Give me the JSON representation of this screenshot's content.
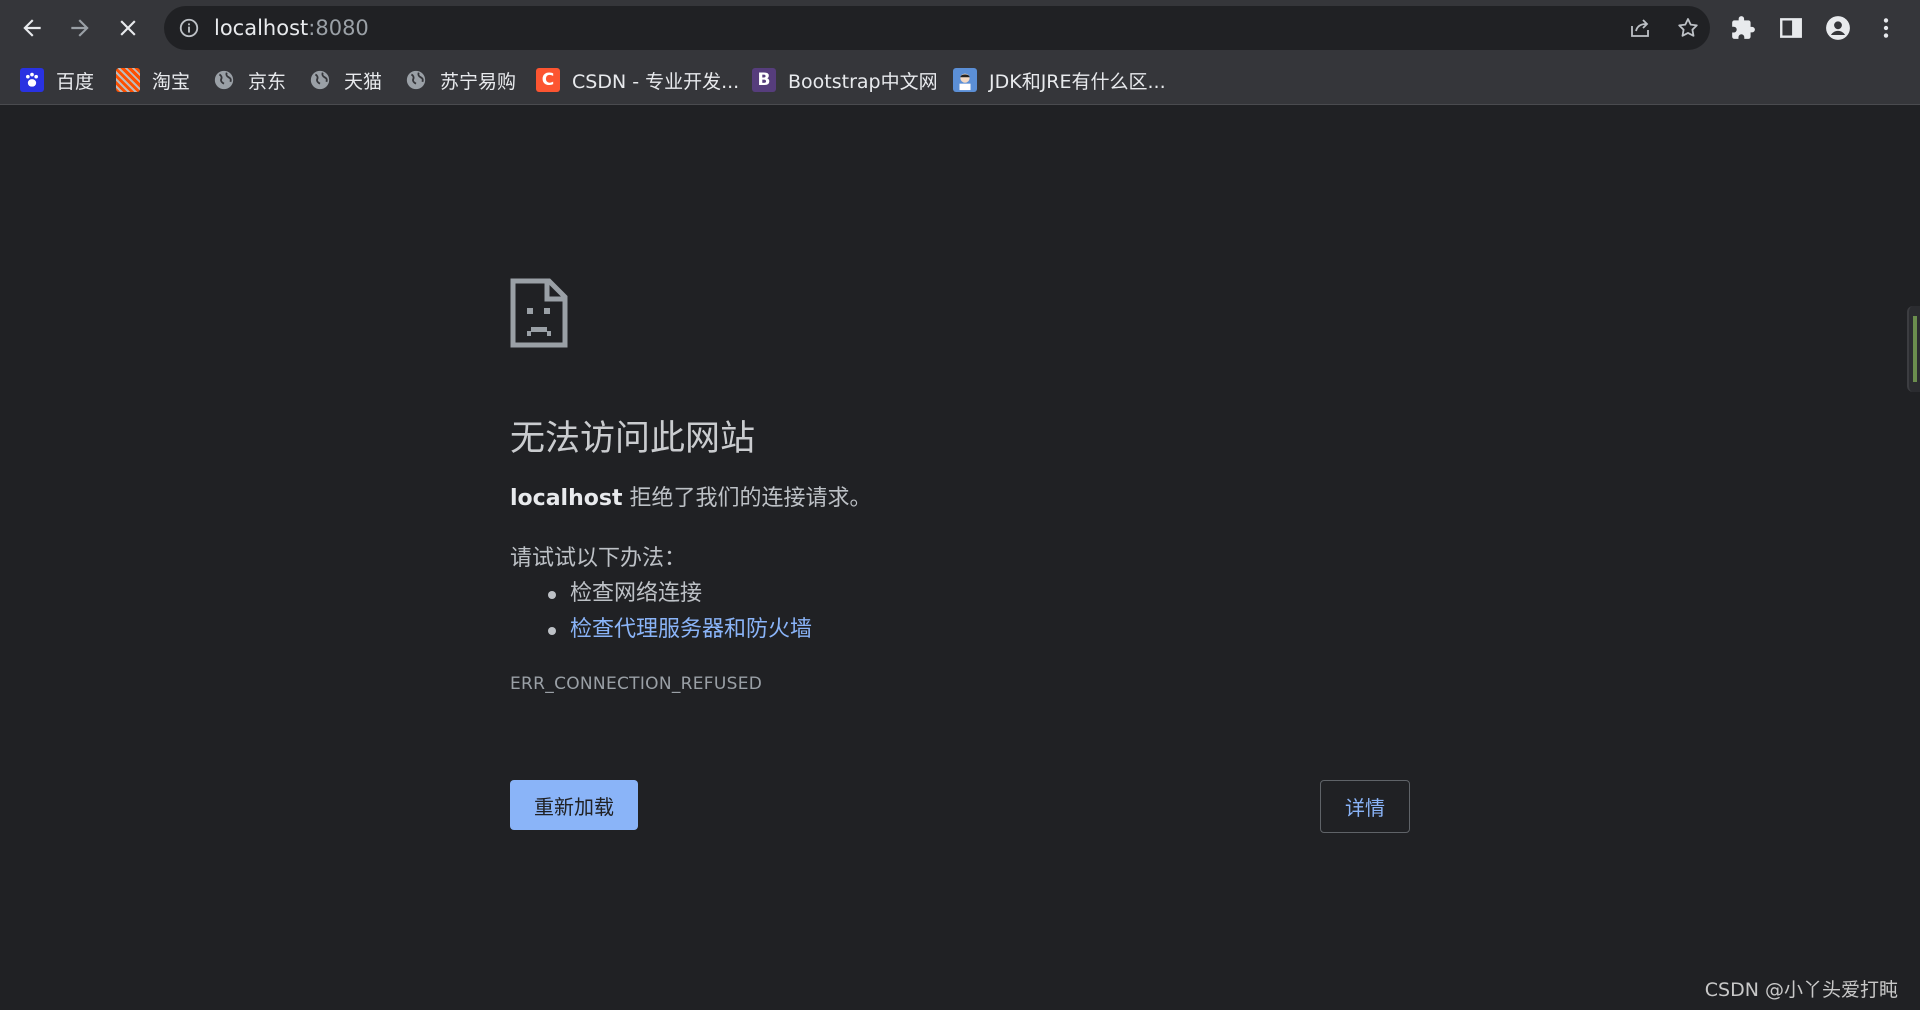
{
  "browser": {
    "url_host": "localhost",
    "url_port": ":8080",
    "buttons": {
      "back_icon": "back-arrow-icon",
      "forward_icon": "forward-arrow-icon",
      "stop_icon": "close-icon"
    }
  },
  "bookmarks": [
    {
      "label": "百度",
      "icon": "baidu-paw-icon",
      "color": "#2932e1"
    },
    {
      "label": "淘宝",
      "icon": "taobao-icon",
      "color": "#ff5000"
    },
    {
      "label": "京东",
      "icon": "globe-icon",
      "color": "#9aa0a6"
    },
    {
      "label": "天猫",
      "icon": "globe-icon",
      "color": "#9aa0a6"
    },
    {
      "label": "苏宁易购",
      "icon": "globe-icon",
      "color": "#9aa0a6"
    },
    {
      "label": "CSDN - 专业开发...",
      "icon": "csdn-icon",
      "glyph": "C",
      "color": "#fc5531"
    },
    {
      "label": "Bootstrap中文网",
      "icon": "bootstrap-icon",
      "glyph": "B",
      "color": "#563d7c"
    },
    {
      "label": "JDK和JRE有什么区...",
      "icon": "avatar-icon",
      "color": "#5b8fd6"
    }
  ],
  "error": {
    "title": "无法访问此网站",
    "host": "localhost",
    "message": " 拒绝了我们的连接请求。",
    "try_heading": "请试试以下办法：",
    "suggestions": [
      "检查网络连接",
      "检查代理服务器和防火墙"
    ],
    "code": "ERR_CONNECTION_REFUSED",
    "reload_label": "重新加载",
    "details_label": "详情"
  },
  "watermark": "CSDN @小丫头爱打盹",
  "colors": {
    "background": "#202124",
    "toolbar": "#35363a",
    "link": "#8ab4f8",
    "primary_button": "#8ab4f8"
  }
}
